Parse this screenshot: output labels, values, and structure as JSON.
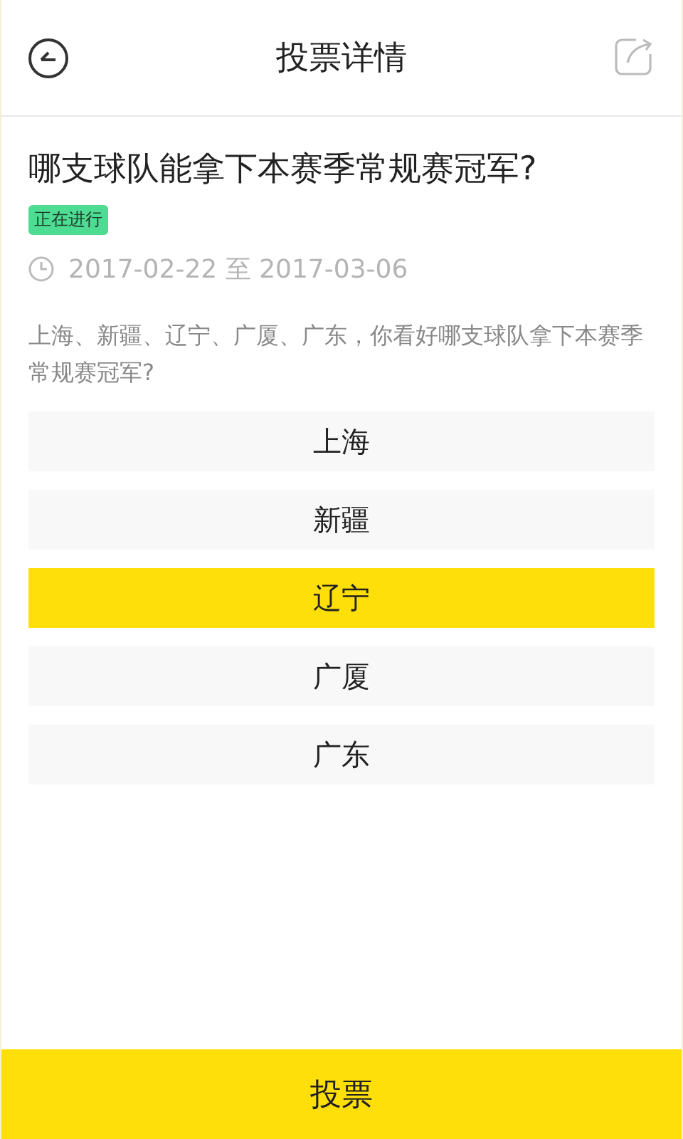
{
  "header": {
    "title": "投票详情"
  },
  "poll": {
    "question": "哪支球队能拿下本赛季常规赛冠军?",
    "status": "正在进行",
    "start": "2017-02-22",
    "separator": "至",
    "end": "2017-03-06",
    "description": "上海、新疆、辽宁、广厦、广东，你看好哪支球队拿下本赛季常规赛冠军?"
  },
  "options": [
    {
      "label": "上海",
      "selected": false
    },
    {
      "label": "新疆",
      "selected": false
    },
    {
      "label": "辽宁",
      "selected": true
    },
    {
      "label": "广厦",
      "selected": false
    },
    {
      "label": "广东",
      "selected": false
    }
  ],
  "submit_button": "投票"
}
